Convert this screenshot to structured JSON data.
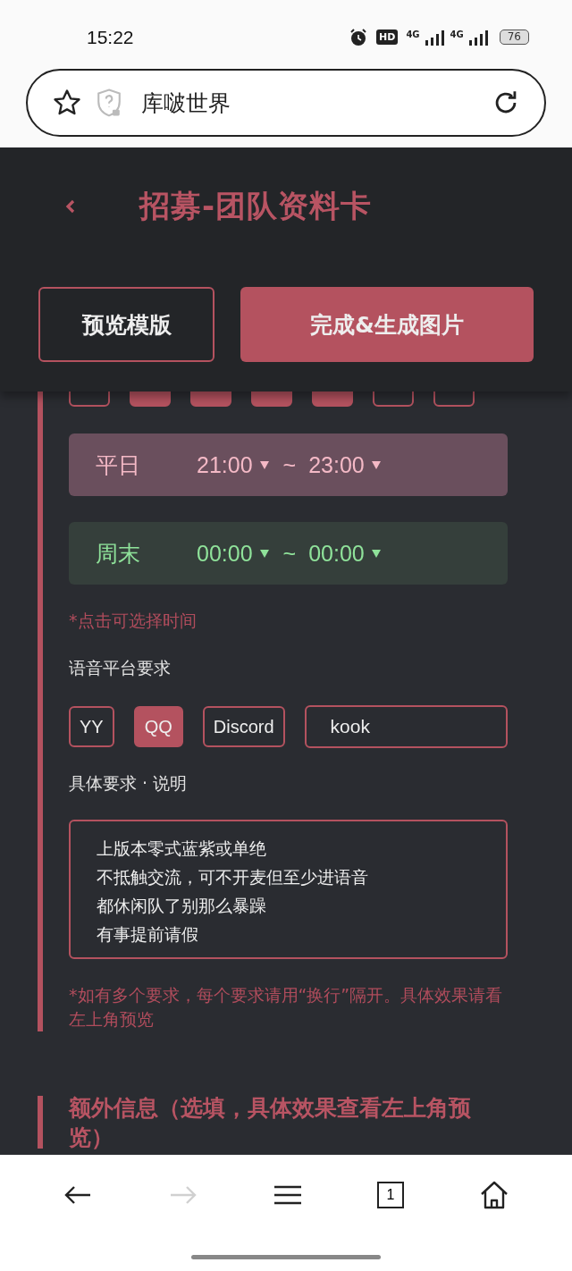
{
  "status_bar": {
    "time": "15:22",
    "hd": "HD",
    "networks": [
      "4G",
      "4G"
    ],
    "battery": "76"
  },
  "address_bar": {
    "site_title": "库啵世界"
  },
  "header": {
    "title": "招募-团队资料卡"
  },
  "actions": [
    {
      "label": "预览模版",
      "kind": "outline"
    },
    {
      "label": "完成&生成图片",
      "kind": "filled"
    }
  ],
  "weekday_chips": [
    {
      "selected": false
    },
    {
      "selected": true
    },
    {
      "selected": true
    },
    {
      "selected": true
    },
    {
      "selected": true
    },
    {
      "selected": false
    },
    {
      "selected": false
    }
  ],
  "time_ranges": [
    {
      "kind": "weekday",
      "label": "平日",
      "start": "21:00",
      "end": "23:00",
      "separator": "~"
    },
    {
      "kind": "weekend",
      "label": "周末",
      "start": "00:00",
      "end": "00:00",
      "separator": "~"
    }
  ],
  "time_note": "*点击可选择时间",
  "voice_label": "语音平台要求",
  "platforms": [
    {
      "label": "YY",
      "selected": false
    },
    {
      "label": "QQ",
      "selected": true
    },
    {
      "label": "Discord",
      "selected": false
    }
  ],
  "platform_other": {
    "value": "kook"
  },
  "details_label": "具体要求 · 说明",
  "details_lines": [
    "上版本零式蓝紫或单绝",
    "不抵触交流，可不开麦但至少进语音",
    "都休闲队了别那么暴躁",
    "有事提前请假"
  ],
  "details_note": "*如有多个要求，每个要求请用“换行”隔开。具体效果请看左上角预览",
  "extra_heading": "额外信息（选填，具体效果查看左上角预览）",
  "bottom_nav": {
    "tab_count": "1",
    "forward_disabled": true
  }
}
